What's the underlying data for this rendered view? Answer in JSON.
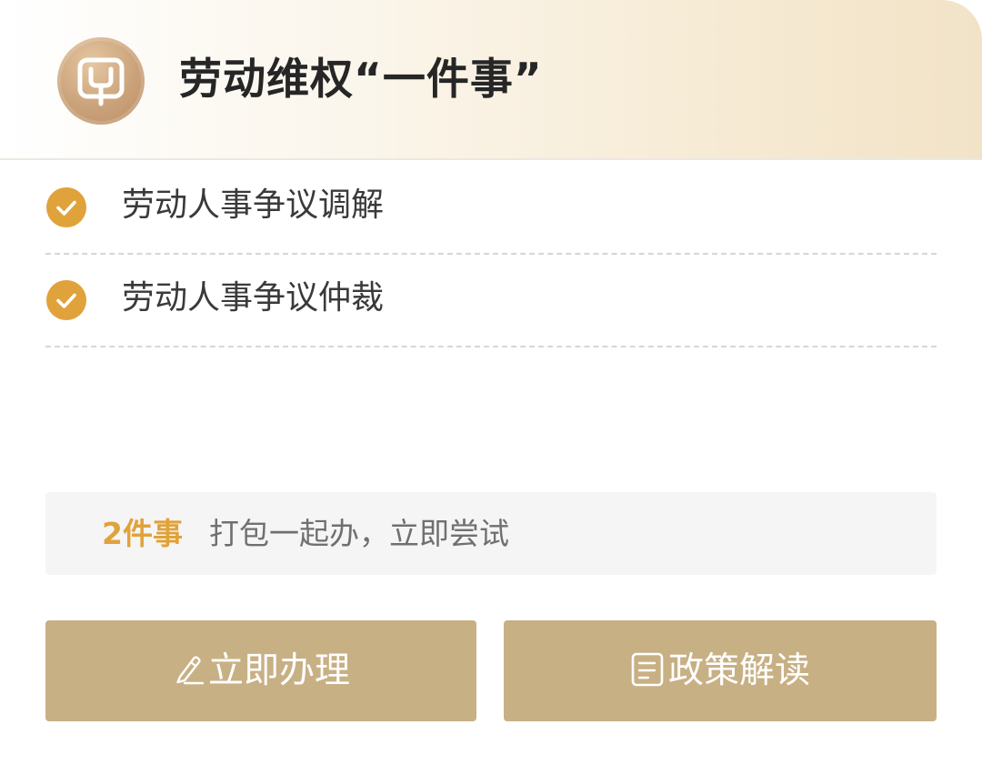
{
  "header": {
    "title": "劳动维权“一件事”",
    "logo_icon": "plug-icon"
  },
  "items": [
    {
      "label": "劳动人事争议调解",
      "checked": true
    },
    {
      "label": "劳动人事争议仲裁",
      "checked": true
    }
  ],
  "bundle": {
    "count_label": "2件事",
    "hint": "打包一起办，立即尝试"
  },
  "actions": {
    "apply_label": "立即办理",
    "apply_icon": "pencil-icon",
    "policy_label": "政策解读",
    "policy_icon": "document-icon"
  },
  "colors": {
    "accent_orange": "#e0a23a",
    "button_gold": "#c8b085",
    "logo_bronze": "#caa27a"
  }
}
